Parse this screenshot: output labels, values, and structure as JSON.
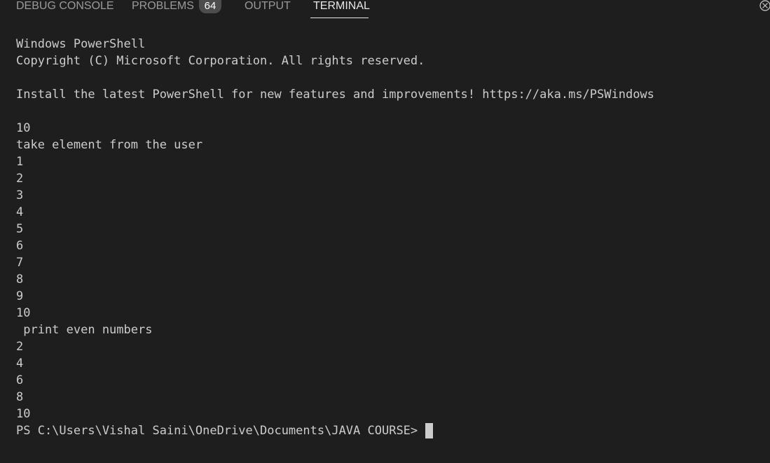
{
  "panel": {
    "tabs": [
      {
        "label": "DEBUG CONSOLE"
      },
      {
        "label": "PROBLEMS"
      },
      {
        "label": "OUTPUT"
      },
      {
        "label": "TERMINAL"
      }
    ],
    "problems_badge": "64",
    "active_tab": "TERMINAL"
  },
  "terminal": {
    "lines": [
      "Windows PowerShell",
      "Copyright (C) Microsoft Corporation. All rights reserved.",
      "",
      "Install the latest PowerShell for new features and improvements! https://aka.ms/PSWindows",
      "",
      "10",
      "take element from the user",
      "1",
      "2",
      "3",
      "4",
      "5",
      "6",
      "7",
      "8",
      "9",
      "10",
      " print even numbers",
      "2",
      "4",
      "6",
      "8",
      "10"
    ],
    "prompt": "PS C:\\Users\\Vishal Saini\\OneDrive\\Documents\\JAVA COURSE>"
  },
  "icons": {
    "close": "close-icon"
  },
  "colors": {
    "background": "#1e1e1e",
    "foreground": "#cccccc",
    "tab_inactive": "#9a9a9a",
    "tab_active": "#e7e7e7",
    "badge": "#4d4d4d"
  }
}
